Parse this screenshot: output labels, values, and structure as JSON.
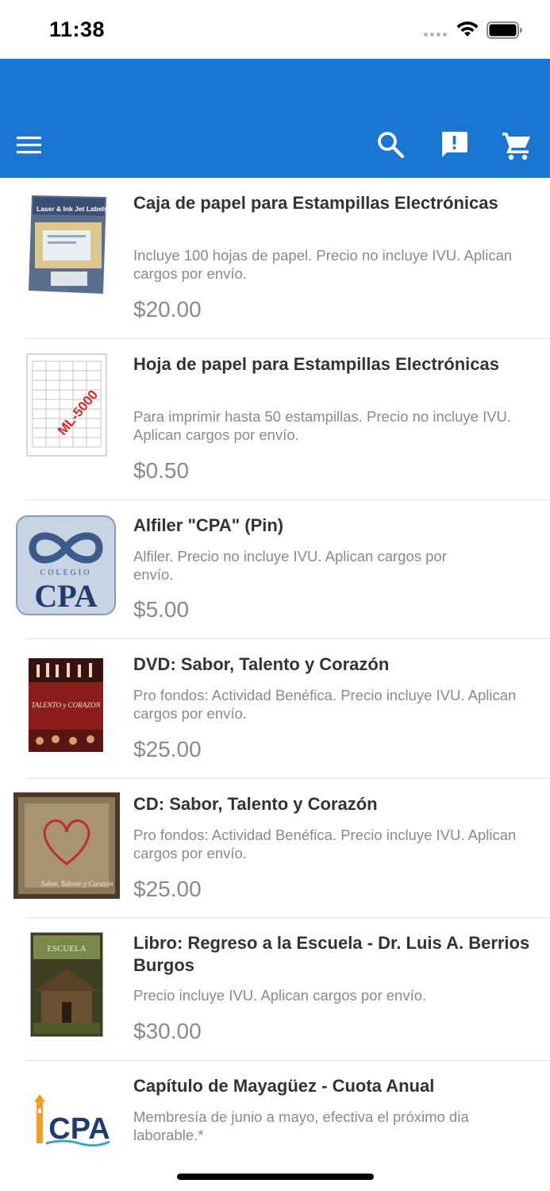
{
  "status_bar": {
    "time": "11:38"
  },
  "app_bar": {
    "color": "#1976d2",
    "icons": [
      "menu-icon",
      "search-icon",
      "feedback-icon",
      "cart-icon"
    ]
  },
  "products": [
    {
      "title": "Caja de papel para Estampillas Electrónicas",
      "description": "Incluye 100 hojas de papel. Precio no incluye IVU. Aplican cargos por envío.",
      "price": "$20.00",
      "thumb_text": "Laser & Ink Jet Labels"
    },
    {
      "title": "Hoja de papel para Estampillas Electrónicas",
      "description": "Para imprimir hasta 50 estampillas. Precio no incluye IVU. Aplican cargos por envío.",
      "price": "$0.50",
      "thumb_text": "ML-5000"
    },
    {
      "title": "Alfiler \"CPA\" (Pin)",
      "description": "Alfiler. Precio no incluye IVU. Aplican cargos por envío.",
      "price": "$5.00",
      "thumb_text": "CPA",
      "thumb_subtext": "COLEGIO"
    },
    {
      "title": "DVD: Sabor, Talento y Corazón",
      "description": "Pro fondos: Actividad Benéfica. Precio incluye IVU. Aplican cargos por envío.",
      "price": "$25.00",
      "thumb_text": "TALENTO y CORAZON"
    },
    {
      "title": "CD: Sabor, Talento y Corazón",
      "description": "Pro fondos: Actividad Benéfica. Precio incluye IVU. Aplican cargos por envío.",
      "price": "$25.00",
      "thumb_text": "Sabor, Talento y Corazón"
    },
    {
      "title": "Libro: Regreso a la Escuela - Dr. Luis A. Berrios Burgos",
      "description": "Precio incluye IVU. Aplican cargos por envío.",
      "price": "$30.00",
      "thumb_text": "ESCUELA"
    },
    {
      "title": "Capítulo de Mayagüez - Cuota Anual",
      "description": "Membresía de junio a mayo, efectiva el próximo dia laborable.*",
      "price": "",
      "thumb_text": "CPA"
    }
  ]
}
